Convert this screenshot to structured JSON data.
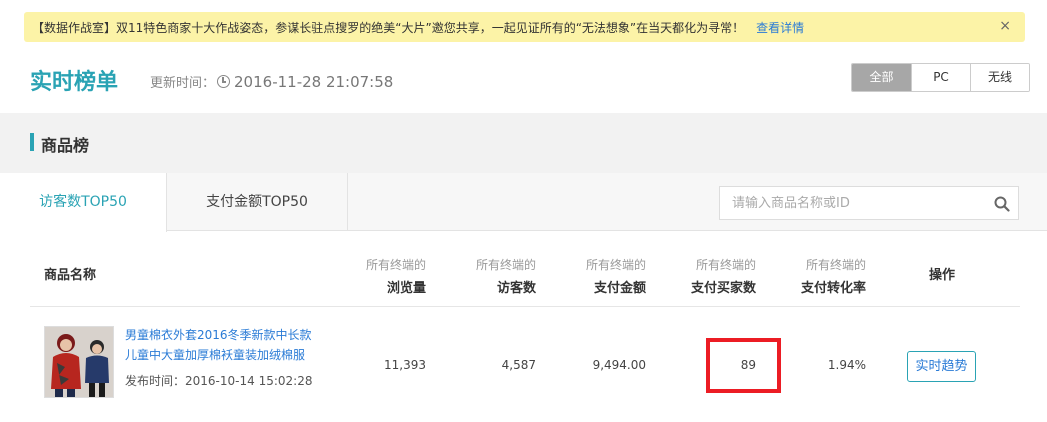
{
  "notice": {
    "text": "【数据作战室】双11特色商家十大作战姿态，参谋长驻点搜罗的绝美“大片”邀您共享，一起见证所有的“无法想象”在当天都化为寻常！",
    "link": "查看详情",
    "close": "×"
  },
  "header": {
    "title": "实时榜单",
    "update_label": "更新时间：",
    "update_time": "2016-11-28 21:07:58",
    "segments": [
      "全部",
      "PC",
      "无线"
    ]
  },
  "section": {
    "label": "商品榜"
  },
  "tabs": {
    "visitors": "访客数TOP50",
    "payment": "支付金额TOP50",
    "search_placeholder": "请输入商品名称或ID"
  },
  "table": {
    "col_name": "商品名称",
    "prefix": "所有终端的",
    "columns": [
      "浏览量",
      "访客数",
      "支付金额",
      "支付买家数",
      "支付转化率"
    ],
    "col_op": "操作",
    "rows": [
      {
        "name": "男童棉衣外套2016冬季新款中长款儿童中大童加厚棉袄童装加绒棉服",
        "publish_label": "发布时间：",
        "publish_time": "2016-10-14 15:02:28",
        "pv": "11,393",
        "uv": "4,587",
        "pay_amount": "9,494.00",
        "buyers": "89",
        "conversion": "1.94%",
        "action": "实时趋势"
      }
    ]
  },
  "colors": {
    "accent": "#2aa3b4",
    "link": "#2a7bd6",
    "notice_bg": "#fcf3a7",
    "highlight": "#ec1c24"
  }
}
